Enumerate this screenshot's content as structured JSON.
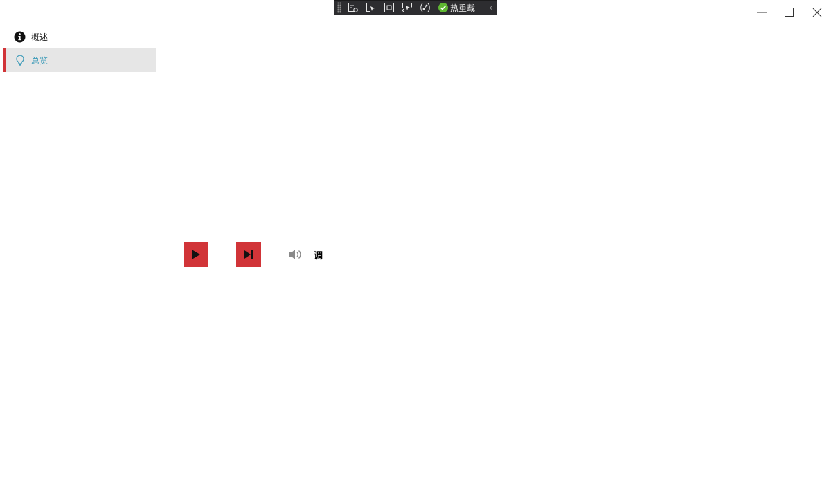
{
  "debug_toolbar": {
    "tools": [
      "live-visual-tree-icon",
      "select-element-icon",
      "display-layout-adorners-icon",
      "track-focused-element-icon",
      "binding-failures-icon"
    ],
    "hot_reload_label": "热重载",
    "hot_reload_status_color": "#5fb832",
    "collapse_glyph": "‹"
  },
  "window_controls": [
    "minimize",
    "maximize",
    "close"
  ],
  "sidebar": {
    "items": [
      {
        "label": "概述",
        "icon": "info-icon",
        "active": false
      },
      {
        "label": "总览",
        "icon": "lightbulb-icon",
        "active": true
      }
    ],
    "accent_color": "#d13438",
    "active_text_color": "#3b9ab8"
  },
  "player": {
    "button_color": "#d13438",
    "buttons": [
      "play-icon",
      "skip-next-icon"
    ],
    "volume_icon": "volume-icon",
    "adjust_label": "调"
  }
}
